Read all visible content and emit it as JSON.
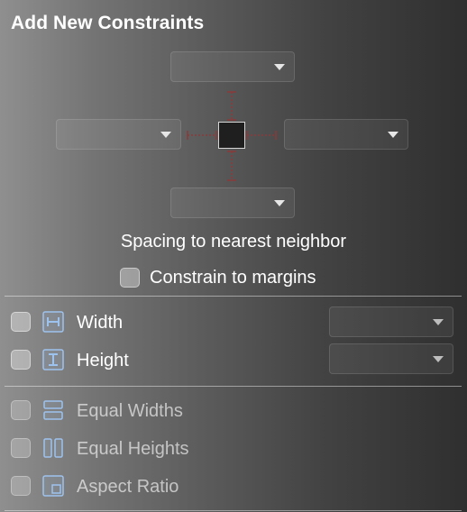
{
  "panel": {
    "title": "Add New Constraints",
    "spacing_label": "Spacing to nearest neighbor",
    "constrain_to_margins_label": "Constrain to margins"
  },
  "size_rows": [
    {
      "label": "Width",
      "icon": "width-constraint-icon"
    },
    {
      "label": "Height",
      "icon": "height-constraint-icon"
    }
  ],
  "equal_rows": [
    {
      "label": "Equal Widths",
      "icon": "equal-widths-icon"
    },
    {
      "label": "Equal Heights",
      "icon": "equal-heights-icon"
    },
    {
      "label": "Aspect Ratio",
      "icon": "aspect-ratio-icon"
    }
  ],
  "colors": {
    "constraint_strut": "#8a3a3a",
    "icon_stroke": "#9ec2ee"
  }
}
